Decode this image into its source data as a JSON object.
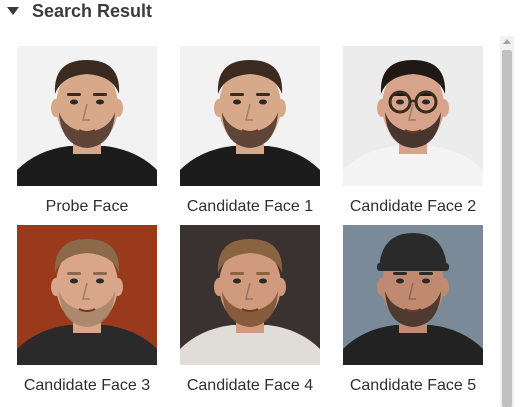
{
  "section": {
    "title": "Search Result",
    "icon": "caret-down-icon"
  },
  "results": [
    {
      "label": "Probe Face",
      "bg": "#f2f2f2",
      "skin": "#d8a88a",
      "hair": "#3a2a20",
      "beard": "#4a3428",
      "shirt": "#1c1c1c",
      "glasses": false,
      "cap": false
    },
    {
      "label": "Candidate Face 1",
      "bg": "#f2f2f2",
      "skin": "#d8a88a",
      "hair": "#3a2a20",
      "beard": "#4a3428",
      "shirt": "#1c1c1c",
      "glasses": false,
      "cap": false
    },
    {
      "label": "Candidate Face 2",
      "bg": "#ececec",
      "skin": "#d7a38a",
      "hair": "#201814",
      "beard": "#2f221c",
      "shirt": "#f4f4f4",
      "glasses": true,
      "cap": false
    },
    {
      "label": "Candidate Face 3",
      "bg": "#9a3a1c",
      "skin": "#d9a68a",
      "hair": "#8a6a48",
      "beard": "#a58468",
      "shirt": "#2a2a2a",
      "glasses": false,
      "cap": false
    },
    {
      "label": "Candidate Face 4",
      "bg": "#3a3230",
      "skin": "#cf9a7e",
      "hair": "#8a6440",
      "beard": "#7a5030",
      "shirt": "#e0dcd8",
      "glasses": false,
      "cap": false
    },
    {
      "label": "Candidate Face 5",
      "bg": "#7a8a98",
      "skin": "#c08a70",
      "hair": "#2a2a2a",
      "beard": "#3a2c24",
      "shirt": "#222222",
      "glasses": false,
      "cap": true
    }
  ]
}
